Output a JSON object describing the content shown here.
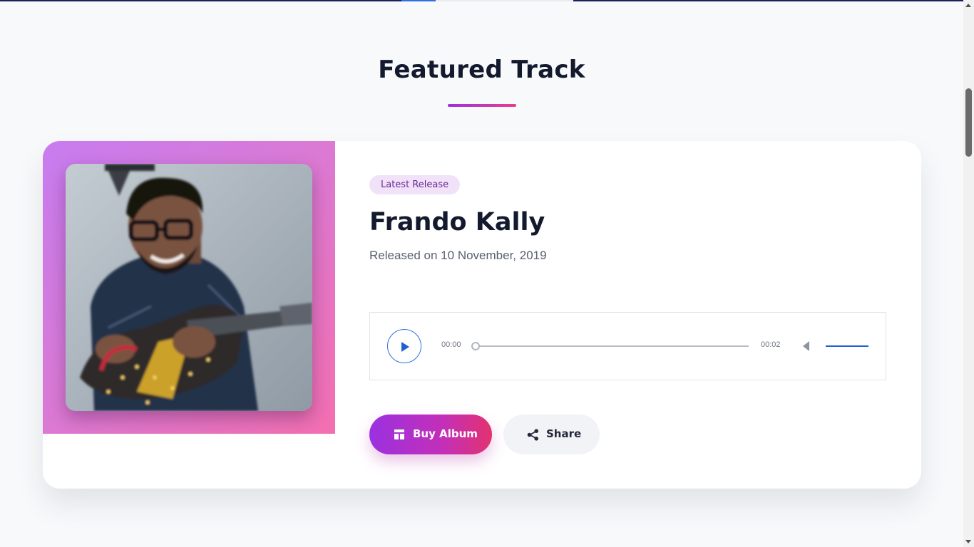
{
  "section": {
    "title": "Featured Track"
  },
  "track": {
    "badge": "Latest Release",
    "artist": "Frando Kally",
    "release_text": "Released on 10 November, 2019",
    "photo_alt": "Frando Kally"
  },
  "player": {
    "current_time": "00:00",
    "duration": "00:02",
    "progress": 0,
    "volume": 1.0,
    "play_icon": "play-icon",
    "volume_icon": "volume-icon"
  },
  "actions": {
    "buy_label": "Buy Album",
    "buy_icon": "album-icon",
    "share_label": "Share",
    "share_icon": "share-icon"
  },
  "colors": {
    "accent_start": "#9a31e0",
    "accent_end": "#e2326f",
    "player_blue": "#2f6fe0",
    "heading": "#141a2e"
  }
}
